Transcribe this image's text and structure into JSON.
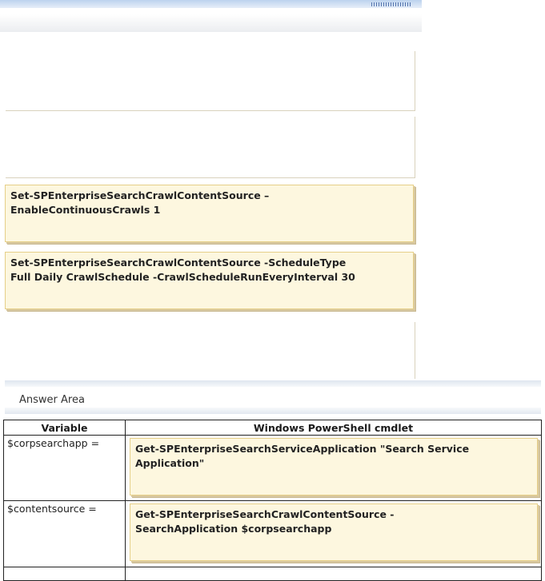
{
  "cmdlet_pool": {
    "card1": "Set-SPEnterpriseSearchCrawlContentSource –\nEnableContinuousCrawls 1",
    "card2": "Set-SPEnterpriseSearchCrawlContentSource -ScheduleType\nFull Daily CrawlSchedule -CrawlScheduleRunEveryInterval 30"
  },
  "answer_area": {
    "title": "Answer Area",
    "headers": {
      "variable": "Variable",
      "cmdlet": "Windows PowerShell cmdlet"
    },
    "rows": [
      {
        "variable": "$corpsearchapp =",
        "cmdlet": "Get-SPEnterpriseSearchServiceApplication \"Search Service\nApplication\""
      },
      {
        "variable": "$contentsource =",
        "cmdlet": "Get-SPEnterpriseSearchCrawlContentSource -\nSearchApplication $corpsearchapp"
      }
    ]
  }
}
